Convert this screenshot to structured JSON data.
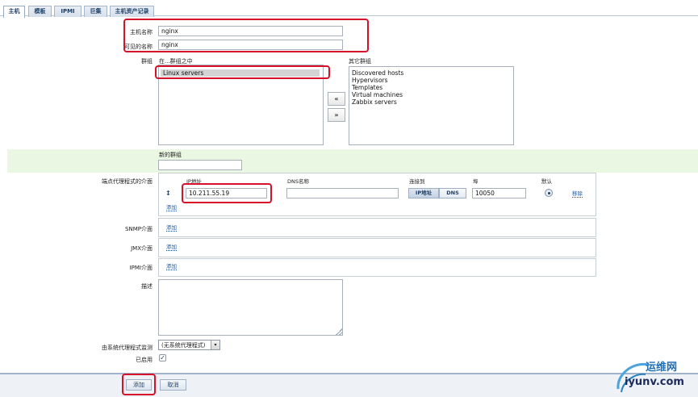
{
  "tabs": [
    {
      "label": "主机",
      "active": true
    },
    {
      "label": "模板",
      "active": false
    },
    {
      "label": "IPMI",
      "active": false
    },
    {
      "label": "巨集",
      "active": false
    },
    {
      "label": "主机资产记录",
      "active": false
    }
  ],
  "form": {
    "host_name_label": "主机名称",
    "host_name_value": "nginx",
    "visible_name_label": "可见的名称",
    "visible_name_value": "nginx",
    "groups_label": "群组",
    "in_groups_label": "在...群组之中",
    "other_groups_label": "其它群组",
    "in_groups": [
      "Linux servers"
    ],
    "other_groups": [
      "Discovered hosts",
      "Hypervisors",
      "Templates",
      "Virtual machines",
      "Zabbix servers"
    ],
    "move_left": "«",
    "move_right": "»",
    "new_group_label": "新的群组",
    "new_group_value": "",
    "agent_iface_label": "端点代理程式的介面",
    "col_ip": "IP地址",
    "col_dns": "DNS名称",
    "col_connect": "连接到",
    "col_port": "埠",
    "col_default": "默认",
    "agent_ip": "10.211.55.19",
    "agent_dns": "",
    "connect_ip": "IP地址",
    "connect_dns": "DNS",
    "agent_port": "10050",
    "remove_link": "移除",
    "add_link": "添加",
    "snmp_label": "SNMP介面",
    "jmx_label": "JMX介面",
    "ipmi_label": "IPMI介面",
    "description_label": "描述",
    "description_value": "",
    "proxy_label": "由系统代理程式监测",
    "proxy_value": "(无系统代理程式)",
    "enabled_label": "已启用"
  },
  "footer": {
    "add_button": "添加",
    "cancel_button": "取消"
  },
  "watermark": {
    "text_cn": "运维网",
    "text_url": "iyunv.com"
  },
  "colors": {
    "highlight_red": "#d8112a",
    "tab_text": "#1d3f66",
    "link_blue": "#1a56a8",
    "green_band": "#eaf8e3"
  }
}
